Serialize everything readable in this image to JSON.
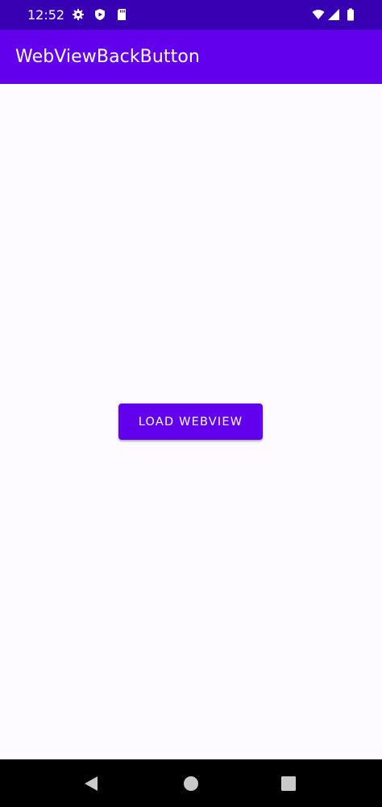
{
  "status_bar": {
    "time": "12:52",
    "left_icons": [
      "gear-icon",
      "shield-play-icon",
      "sd-card-icon"
    ],
    "right_icons": [
      "wifi-icon",
      "cell-signal-icon",
      "battery-icon"
    ],
    "background": "#3700b3"
  },
  "app_bar": {
    "title": "WebViewBackButton",
    "background": "#6200ee"
  },
  "main": {
    "load_button_label": "LOAD WEBVIEW",
    "button_color": "#6200ee"
  },
  "nav_bar": {
    "buttons": [
      "back-icon",
      "home-icon",
      "recents-icon"
    ]
  }
}
